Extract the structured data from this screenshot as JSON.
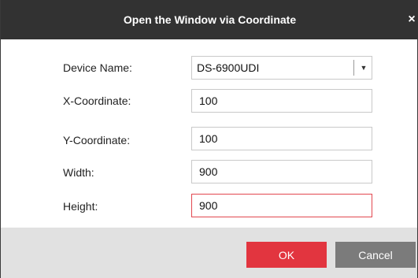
{
  "dialog": {
    "title": "Open the Window via Coordinate",
    "close_glyph": "×"
  },
  "form": {
    "device_name": {
      "label": "Device Name:",
      "value": "DS-6900UDI",
      "arrow_glyph": "▼"
    },
    "x_coordinate": {
      "label": "X-Coordinate:",
      "value": "100"
    },
    "y_coordinate": {
      "label": "Y-Coordinate:",
      "value": "100"
    },
    "width": {
      "label": "Width:",
      "value": "900"
    },
    "height": {
      "label": "Height:",
      "value": "900"
    }
  },
  "buttons": {
    "ok": "OK",
    "cancel": "Cancel"
  },
  "colors": {
    "titlebar": "#323232",
    "accent": "#e2353f",
    "secondary_button": "#7b7b7b",
    "footer": "#e1e1e1",
    "invalid_border": "#e2474f"
  }
}
